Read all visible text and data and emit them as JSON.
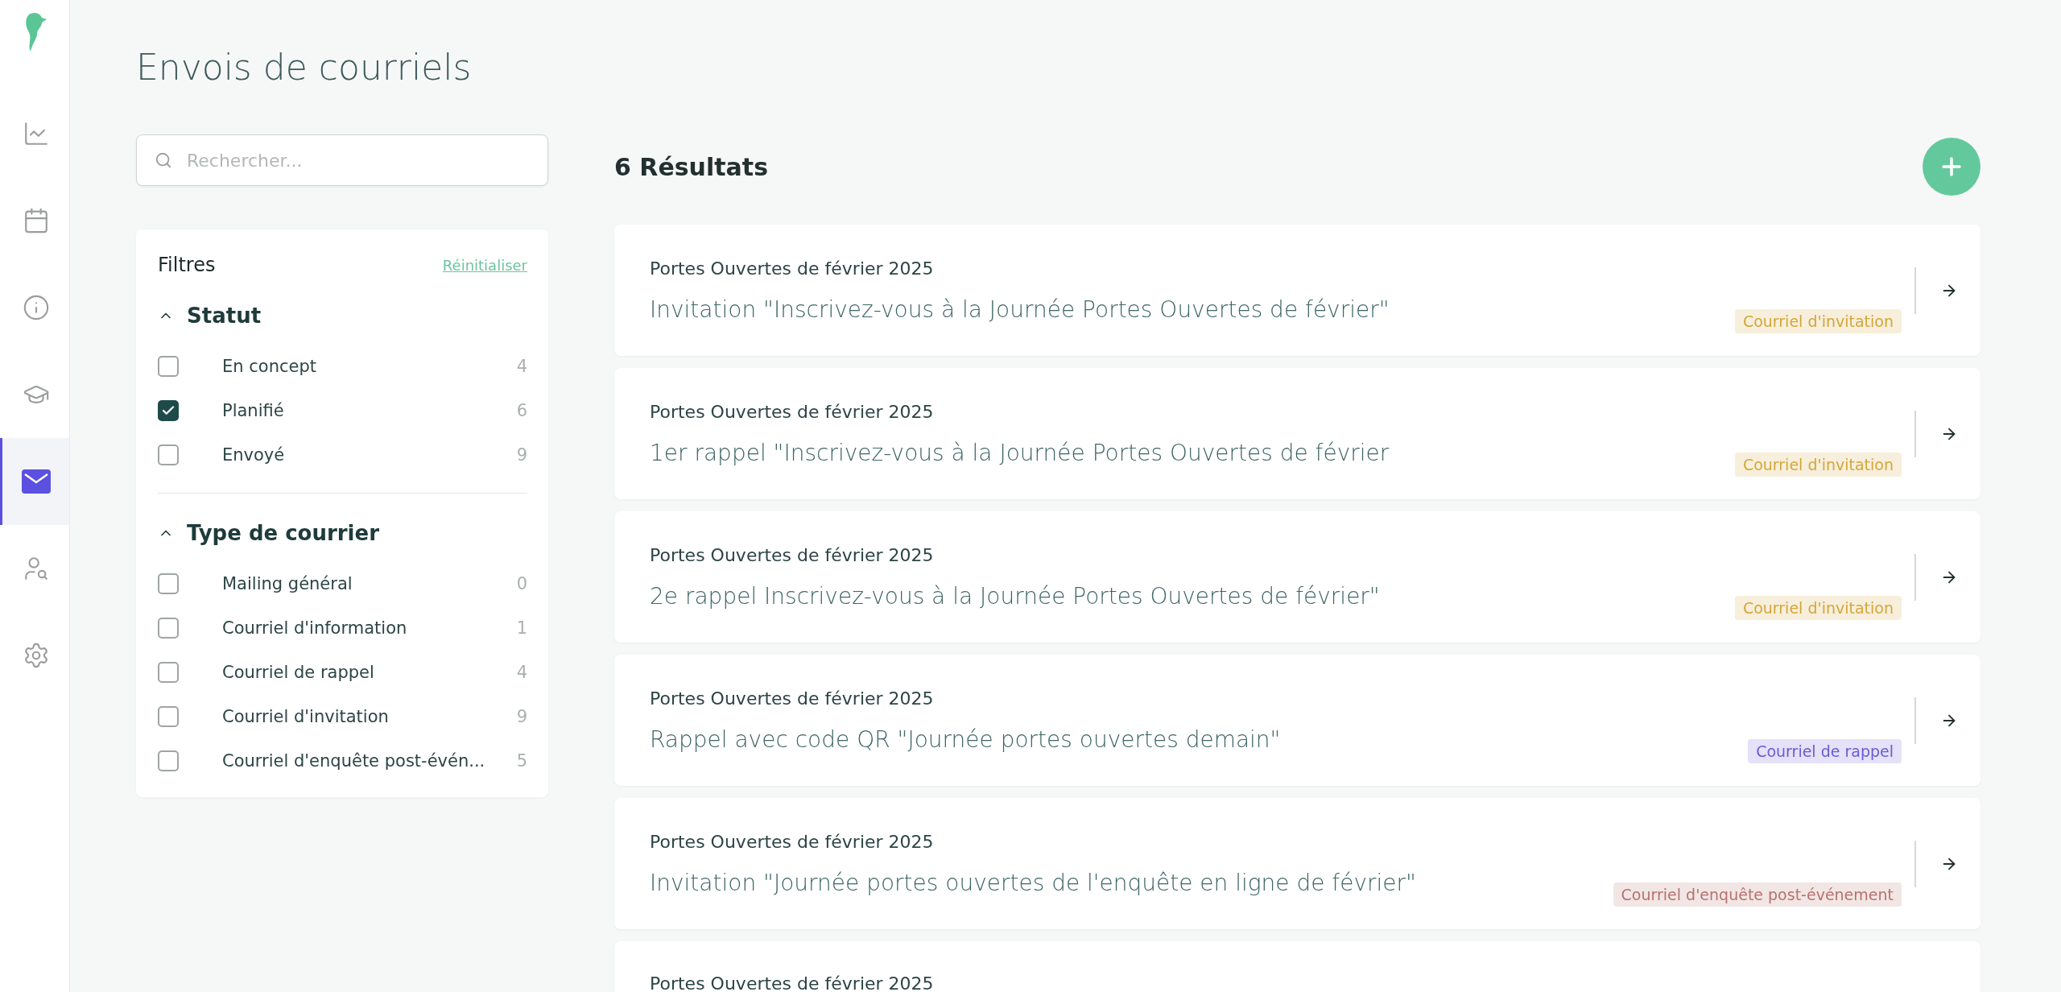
{
  "sidebar": {
    "items": [
      {
        "kind": "chart",
        "selected": false
      },
      {
        "kind": "calendar",
        "selected": false
      },
      {
        "kind": "info",
        "selected": false
      },
      {
        "kind": "school",
        "selected": false
      },
      {
        "kind": "mail",
        "selected": true
      },
      {
        "kind": "usersearch",
        "selected": false
      },
      {
        "kind": "settings",
        "selected": false
      }
    ]
  },
  "page": {
    "title": "Envois de courriels"
  },
  "search": {
    "placeholder": "Rechercher..."
  },
  "filters": {
    "title": "Filtres",
    "reset": "Réinitialiser",
    "groups": [
      {
        "title": "Statut",
        "expanded": true,
        "options": [
          {
            "label": "En concept",
            "count": "4",
            "checked": false
          },
          {
            "label": "Planifié",
            "count": "6",
            "checked": true
          },
          {
            "label": "Envoyé",
            "count": "9",
            "checked": false
          }
        ]
      },
      {
        "title": "Type de courrier",
        "expanded": true,
        "options": [
          {
            "label": "Mailing général",
            "count": "0",
            "checked": false
          },
          {
            "label": "Courriel d'information",
            "count": "1",
            "checked": false
          },
          {
            "label": "Courriel de rappel",
            "count": "4",
            "checked": false
          },
          {
            "label": "Courriel d'invitation",
            "count": "9",
            "checked": false
          },
          {
            "label": "Courriel d'enquête post-évén...",
            "count": "5",
            "checked": false
          }
        ]
      }
    ]
  },
  "results": {
    "count": "6 Résultats",
    "items": [
      {
        "event": "Portes Ouvertes de février 2025",
        "title": "Invitation \"Inscrivez-vous à la Journée Portes Ouvertes de février\"",
        "tag": "Courriel d'invitation",
        "color": "#d4a63a"
      },
      {
        "event": "Portes Ouvertes de février 2025",
        "title": "1er rappel \"Inscrivez-vous à la Journée Portes Ouvertes de février",
        "tag": "Courriel d'invitation",
        "color": "#d4a63a"
      },
      {
        "event": "Portes Ouvertes de février 2025",
        "title": "2e rappel Inscrivez-vous à la Journée Portes Ouvertes de février\"",
        "tag": "Courriel d'invitation",
        "color": "#d4a63a"
      },
      {
        "event": "Portes Ouvertes de février 2025",
        "title": "Rappel avec code QR \"Journée portes ouvertes demain\"",
        "tag": "Courriel de rappel",
        "color": "#6a5bd6"
      },
      {
        "event": "Portes Ouvertes de février 2025",
        "title": "Invitation \"Journée portes ouvertes de l'enquête en ligne de février\"",
        "tag": "Courriel d'enquête post-événement",
        "color": "#b5726e"
      },
      {
        "event": "Portes Ouvertes de février 2025"
      }
    ]
  }
}
